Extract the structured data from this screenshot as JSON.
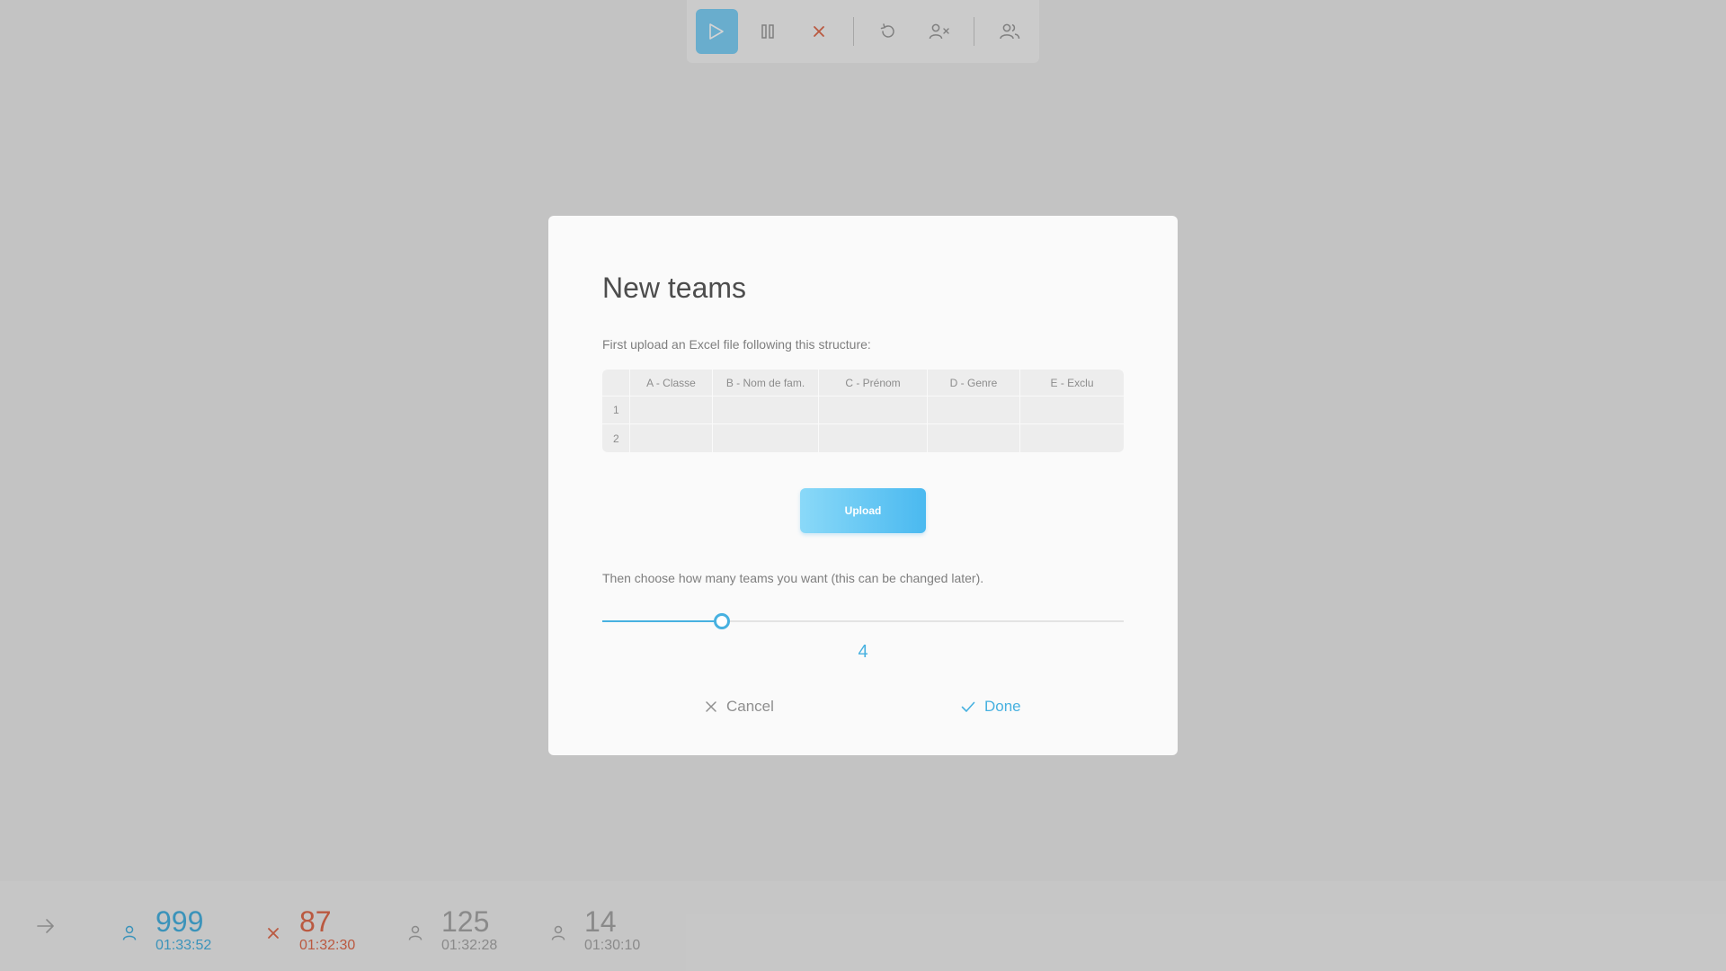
{
  "toolbar": {
    "buttons": [
      {
        "icon": "play-icon",
        "active": true
      },
      {
        "icon": "pause-icon"
      },
      {
        "icon": "close-icon"
      },
      {
        "icon": "reset-icon"
      },
      {
        "icon": "remove-user-icon"
      },
      {
        "icon": "users-icon"
      }
    ]
  },
  "status_bar": {
    "stats": [
      {
        "icon": "user-icon",
        "value": "999",
        "time": "01:33:52",
        "color": "#47b1e0"
      },
      {
        "icon": "close-icon",
        "value": "87",
        "time": "01:32:30",
        "color": "#e06b4e"
      },
      {
        "icon": "user-icon",
        "value": "125",
        "time": "01:32:28",
        "color": "#a6a6a6"
      },
      {
        "icon": "user-icon",
        "value": "14",
        "time": "01:30:10",
        "color": "#a6a6a6"
      }
    ]
  },
  "modal": {
    "title": "New teams",
    "instruction_upload": "First upload an Excel file following this structure:",
    "table": {
      "columns": [
        "A - Classe",
        "B - Nom de fam.",
        "C - Prénom",
        "D - Genre",
        "E - Exclu"
      ],
      "rows": [
        "1",
        "2"
      ]
    },
    "upload_label": "Upload",
    "instruction_teams": "Then choose how many teams you want (this can be changed later).",
    "slider": {
      "value": "4",
      "fraction": 0.23
    },
    "cancel_label": "Cancel",
    "done_label": "Done"
  },
  "colors": {
    "accent": "#47b1e0",
    "danger": "#e06b4e",
    "muted": "#a6a6a6"
  }
}
